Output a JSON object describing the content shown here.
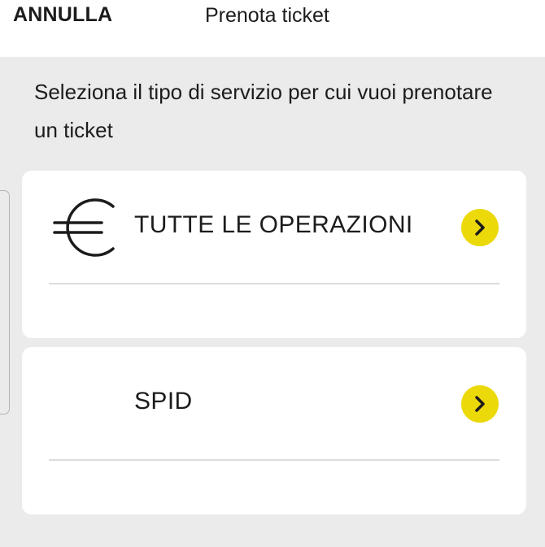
{
  "header": {
    "cancel_label": "ANNULLA",
    "title": "Prenota ticket"
  },
  "intro": {
    "text": "Seleziona il tipo di servizio per cui vuoi prenotare un ticket"
  },
  "services": [
    {
      "label": "TUTTE LE OPERAZIONI",
      "icon": "euro-icon"
    },
    {
      "label": "SPID",
      "icon": ""
    }
  ],
  "colors": {
    "background": "#ebebeb",
    "card": "#ffffff",
    "accent": "#ecd90a",
    "text": "#1c1c1c"
  }
}
